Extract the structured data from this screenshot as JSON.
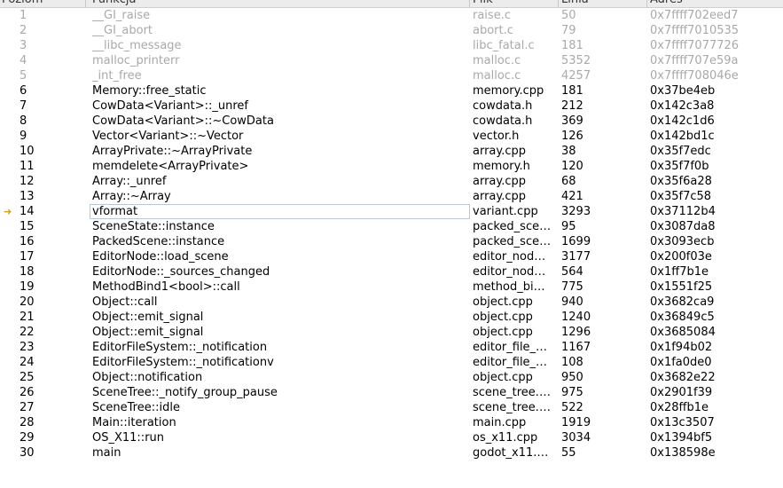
{
  "columns": {
    "level": "Poziom",
    "function": "Funkcja",
    "file": "Plik",
    "line": "Linia",
    "address": "Adres"
  },
  "current_frame": 14,
  "frames": [
    {
      "level": "1",
      "function": "__GI_raise",
      "file": "raise.c",
      "line": "50",
      "address": "0x7ffff702eed7",
      "dim": true
    },
    {
      "level": "2",
      "function": "__GI_abort",
      "file": "abort.c",
      "line": "79",
      "address": "0x7ffff7010535",
      "dim": true
    },
    {
      "level": "3",
      "function": "__libc_message",
      "file": "libc_fatal.c",
      "line": "181",
      "address": "0x7ffff7077726",
      "dim": true
    },
    {
      "level": "4",
      "function": "malloc_printerr",
      "file": "malloc.c",
      "line": "5352",
      "address": "0x7ffff707e59a",
      "dim": true
    },
    {
      "level": "5",
      "function": "_int_free",
      "file": "malloc.c",
      "line": "4257",
      "address": "0x7ffff708046e",
      "dim": true
    },
    {
      "level": "6",
      "function": "Memory::free_static",
      "file": "memory.cpp",
      "line": "181",
      "address": "0x37be4eb"
    },
    {
      "level": "7",
      "function": "CowData<Variant>::_unref",
      "file": "cowdata.h",
      "line": "212",
      "address": "0x142c3a8"
    },
    {
      "level": "8",
      "function": "CowData<Variant>::~CowData",
      "file": "cowdata.h",
      "line": "369",
      "address": "0x142c1d6"
    },
    {
      "level": "9",
      "function": "Vector<Variant>::~Vector",
      "file": "vector.h",
      "line": "126",
      "address": "0x142bd1c"
    },
    {
      "level": "10",
      "function": "ArrayPrivate::~ArrayPrivate",
      "file": "array.cpp",
      "line": "38",
      "address": "0x35f7edc"
    },
    {
      "level": "11",
      "function": "memdelete<ArrayPrivate>",
      "file": "memory.h",
      "line": "120",
      "address": "0x35f7f0b"
    },
    {
      "level": "12",
      "function": "Array::_unref",
      "file": "array.cpp",
      "line": "68",
      "address": "0x35f6a28"
    },
    {
      "level": "13",
      "function": "Array::~Array",
      "file": "array.cpp",
      "line": "421",
      "address": "0x35f7c58"
    },
    {
      "level": "14",
      "function": "vformat",
      "file": "variant.cpp",
      "line": "3293",
      "address": "0x37112b4"
    },
    {
      "level": "15",
      "function": "SceneState::instance",
      "file": "packed_sce…",
      "line": "95",
      "address": "0x3087da8"
    },
    {
      "level": "16",
      "function": "PackedScene::instance",
      "file": "packed_sce…",
      "line": "1699",
      "address": "0x3093ecb"
    },
    {
      "level": "17",
      "function": "EditorNode::load_scene",
      "file": "editor_nod…",
      "line": "3177",
      "address": "0x200f03e"
    },
    {
      "level": "18",
      "function": "EditorNode::_sources_changed",
      "file": "editor_nod…",
      "line": "564",
      "address": "0x1ff7b1e"
    },
    {
      "level": "19",
      "function": "MethodBind1<bool>::call",
      "file": "method_bi…",
      "line": "775",
      "address": "0x1551f25"
    },
    {
      "level": "20",
      "function": "Object::call",
      "file": "object.cpp",
      "line": "940",
      "address": "0x3682ca9"
    },
    {
      "level": "21",
      "function": "Object::emit_signal",
      "file": "object.cpp",
      "line": "1240",
      "address": "0x36849c5"
    },
    {
      "level": "22",
      "function": "Object::emit_signal",
      "file": "object.cpp",
      "line": "1296",
      "address": "0x3685084"
    },
    {
      "level": "23",
      "function": "EditorFileSystem::_notification",
      "file": "editor_file_…",
      "line": "1167",
      "address": "0x1f94b02"
    },
    {
      "level": "24",
      "function": "EditorFileSystem::_notificationv",
      "file": "editor_file_…",
      "line": "108",
      "address": "0x1fa0de0"
    },
    {
      "level": "25",
      "function": "Object::notification",
      "file": "object.cpp",
      "line": "950",
      "address": "0x3682e22"
    },
    {
      "level": "26",
      "function": "SceneTree::_notify_group_pause",
      "file": "scene_tree.…",
      "line": "975",
      "address": "0x2901f39"
    },
    {
      "level": "27",
      "function": "SceneTree::idle",
      "file": "scene_tree.…",
      "line": "522",
      "address": "0x28ffb1e"
    },
    {
      "level": "28",
      "function": "Main::iteration",
      "file": "main.cpp",
      "line": "1919",
      "address": "0x13c3507"
    },
    {
      "level": "29",
      "function": "OS_X11::run",
      "file": "os_x11.cpp",
      "line": "3034",
      "address": "0x1394bf5"
    },
    {
      "level": "30",
      "function": "main",
      "file": "godot_x11.…",
      "line": "55",
      "address": "0x138598e"
    }
  ]
}
